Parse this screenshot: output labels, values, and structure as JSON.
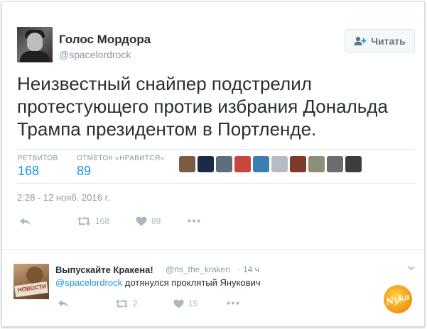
{
  "tweet": {
    "display_name": "Голос Мордора",
    "screen_name": "@spacelordrock",
    "follow_label": "Читать",
    "text": "Неизвестный снайпер подстрелил протестующего против избрания Дональда Трампа президентом в Портленде.",
    "stats": {
      "retweets_label": "РЕТВИТОВ",
      "retweets_value": "168",
      "likes_label": "ОТМЕТОК «НРАВИТСЯ»",
      "likes_value": "89"
    },
    "likers": [
      {
        "name": "liker-1",
        "color": "#7a5b44"
      },
      {
        "name": "liker-2",
        "color": "#1c2a4a"
      },
      {
        "name": "liker-3",
        "color": "#5e6e7d"
      },
      {
        "name": "liker-4",
        "color": "#c9463d"
      },
      {
        "name": "liker-5",
        "color": "#3c7fb0"
      },
      {
        "name": "liker-6",
        "color": "#b7bcc2"
      },
      {
        "name": "liker-7",
        "color": "#7e3a2a"
      },
      {
        "name": "liker-8",
        "color": "#8a8f75"
      },
      {
        "name": "liker-9",
        "color": "#6c6c6c"
      },
      {
        "name": "liker-10",
        "color": "#3d3d3d"
      }
    ],
    "timestamp": "2:28 - 12 нояб. 2016 г.",
    "actions": {
      "retweet_count": "168",
      "like_count": "89"
    }
  },
  "reply": {
    "display_name": "Выпускайте Кракена!",
    "screen_name": "@rls_the_kraken",
    "separator": "·",
    "time": "14 ч",
    "mention": "@spacelordrock",
    "text": " дотянулся проклятый Янукович",
    "avatar_caption": "НОВОСТИ",
    "actions": {
      "retweet_count": "2",
      "like_count": "15"
    }
  },
  "watermark": {
    "text": "Nyka"
  },
  "colors": {
    "accent": "#1b95e0",
    "muted": "#8899a6",
    "text": "#292f33",
    "action_icon": "#aab8c2"
  },
  "icons": [
    "follow-user-icon",
    "reply-icon",
    "retweet-icon",
    "heart-icon",
    "more-icon",
    "chevron-down-icon"
  ]
}
